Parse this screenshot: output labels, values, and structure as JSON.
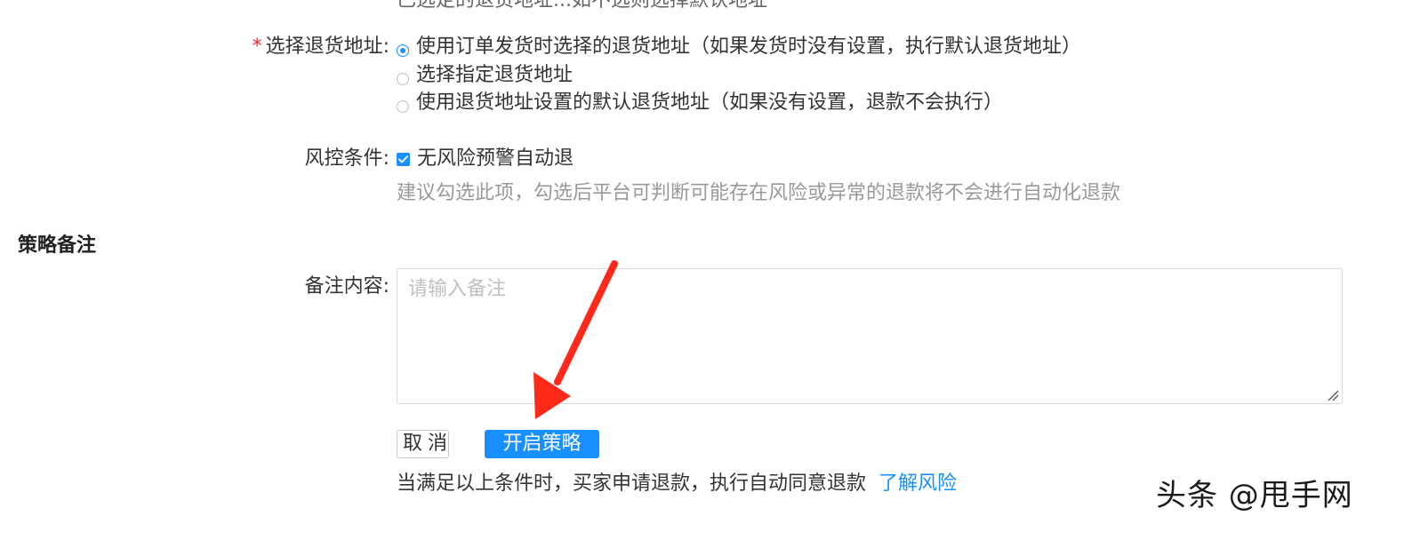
{
  "top_partial_text": "已选定的退货地址...如不选则选择默认地址",
  "return_address": {
    "required_mark": "*",
    "label": "选择退货地址:",
    "options": [
      {
        "label": "使用订单发货时选择的退货地址（如果发货时没有设置，执行默认退货地址）",
        "checked": true
      },
      {
        "label": "选择指定退货地址",
        "checked": false
      },
      {
        "label": "使用退货地址设置的默认退货地址（如果没有设置，退款不会执行）",
        "checked": false
      }
    ]
  },
  "risk_control": {
    "label": "风控条件:",
    "checkbox_label": "无风险预警自动退",
    "checked": true,
    "hint": "建议勾选此项，勾选后平台可判断可能存在风险或异常的退款将不会进行自动化退款"
  },
  "strategy_remark": {
    "section_title": "策略备注",
    "label": "备注内容:",
    "value": "",
    "placeholder": "请输入备注"
  },
  "buttons": {
    "cancel": "取消",
    "submit": "开启策略"
  },
  "footer": {
    "text": "当满足以上条件时，买家申请退款，执行自动同意退款",
    "link": "了解风险"
  },
  "watermark": "头条 @甩手网",
  "colors": {
    "primary": "#1890ff",
    "required": "#f5222d",
    "annotation_arrow": "#ff2a1a",
    "hint": "#999999"
  },
  "icons": {
    "radio_checked": "radio-checked-icon",
    "radio_unchecked": "radio-unchecked-icon",
    "checkbox_checked": "checkbox-checked-icon",
    "resize_handle": "resize-handle-icon",
    "annotation_arrow": "red-arrow-icon"
  }
}
